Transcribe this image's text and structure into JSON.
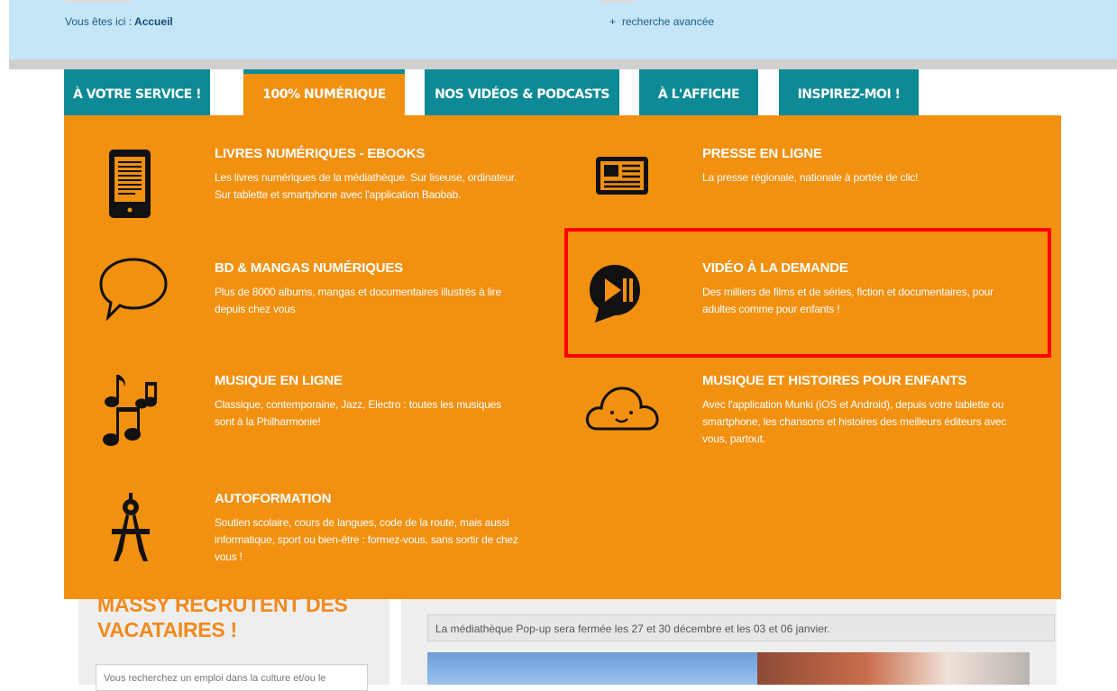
{
  "topbar": {
    "breadcrumb_label": "Vous êtes ici :",
    "breadcrumb_home": "Accueil",
    "advanced_search_plus": "+",
    "advanced_search_label": "recherche avancée"
  },
  "tabs": [
    {
      "label": "À VOTRE SERVICE !"
    },
    {
      "label": "100% NUMÉRIQUE",
      "active": true
    },
    {
      "label": "NOS VIDÉOS & PODCASTS"
    },
    {
      "label": "À L'AFFICHE"
    },
    {
      "label": "INSPIREZ-MOI !"
    }
  ],
  "menu": {
    "items": [
      {
        "title": "LIVRES NUMÉRIQUES - EBOOKS",
        "desc1": "Les livres numériques de la médiathèque. Sur liseuse, ordinateur.",
        "desc2": "Sur tablette et smartphone avec l'application Baobab.",
        "desc3": "",
        "icon": "ereader-icon"
      },
      {
        "title": "PRESSE EN LIGNE",
        "desc1": "La presse régionale, nationale à portée de clic!",
        "desc2": "",
        "desc3": "",
        "icon": "newspaper-icon"
      },
      {
        "title": "BD & MANGAS NUMÉRIQUES",
        "desc1": "Plus de 8000 albums, mangas et documentaires illustrés à lire",
        "desc2": "depuis chez vous",
        "desc3": "",
        "icon": "speech-bubble-icon"
      },
      {
        "title": "VIDÉO À LA DEMANDE",
        "desc1": "Des milliers de films et de séries, fiction et documentaires, pour",
        "desc2": "adultes comme pour enfants !",
        "desc3": "",
        "icon": "play-pause-bubble-icon"
      },
      {
        "title": "MUSIQUE EN LIGNE",
        "desc1": "Classique, contemporaine, Jazz, Electro : toutes les musiques",
        "desc2": "sont à la Philharmonie!",
        "desc3": "",
        "icon": "music-notes-icon"
      },
      {
        "title": "MUSIQUE ET HISTOIRES POUR ENFANTS",
        "desc1": "Avec l'application Munki (iOS et Android), depuis votre tablette ou",
        "desc2": "smartphone, les chansons et histoires des meilleurs éditeurs avec",
        "desc3": "vous, partout.",
        "icon": "smiling-cloud-icon"
      },
      {
        "title": "AUTOFORMATION",
        "desc1": "Soutien scolaire, cours de langues, code de la route, mais aussi",
        "desc2": "informatique, sport ou bien-être : formez-vous, sans sortir de chez",
        "desc3": "vous !",
        "icon": "compass-icon"
      }
    ]
  },
  "page": {
    "recruit_line1": "MASSY RECRUTENT DES",
    "recruit_line2": "VACATAIRES !",
    "left_box_text": "Vous recherchez un emploi dans la culture et/ou le",
    "notice": "La médiathèque Pop-up sera fermée les 27 et 30 décembre et les 03 et 06 janvier."
  },
  "colors": {
    "menu_orange": "#f29010",
    "tab_teal": "#0d8a95",
    "highlight_red": "#ff0000",
    "topbar_blue": "#c5e6f6"
  }
}
